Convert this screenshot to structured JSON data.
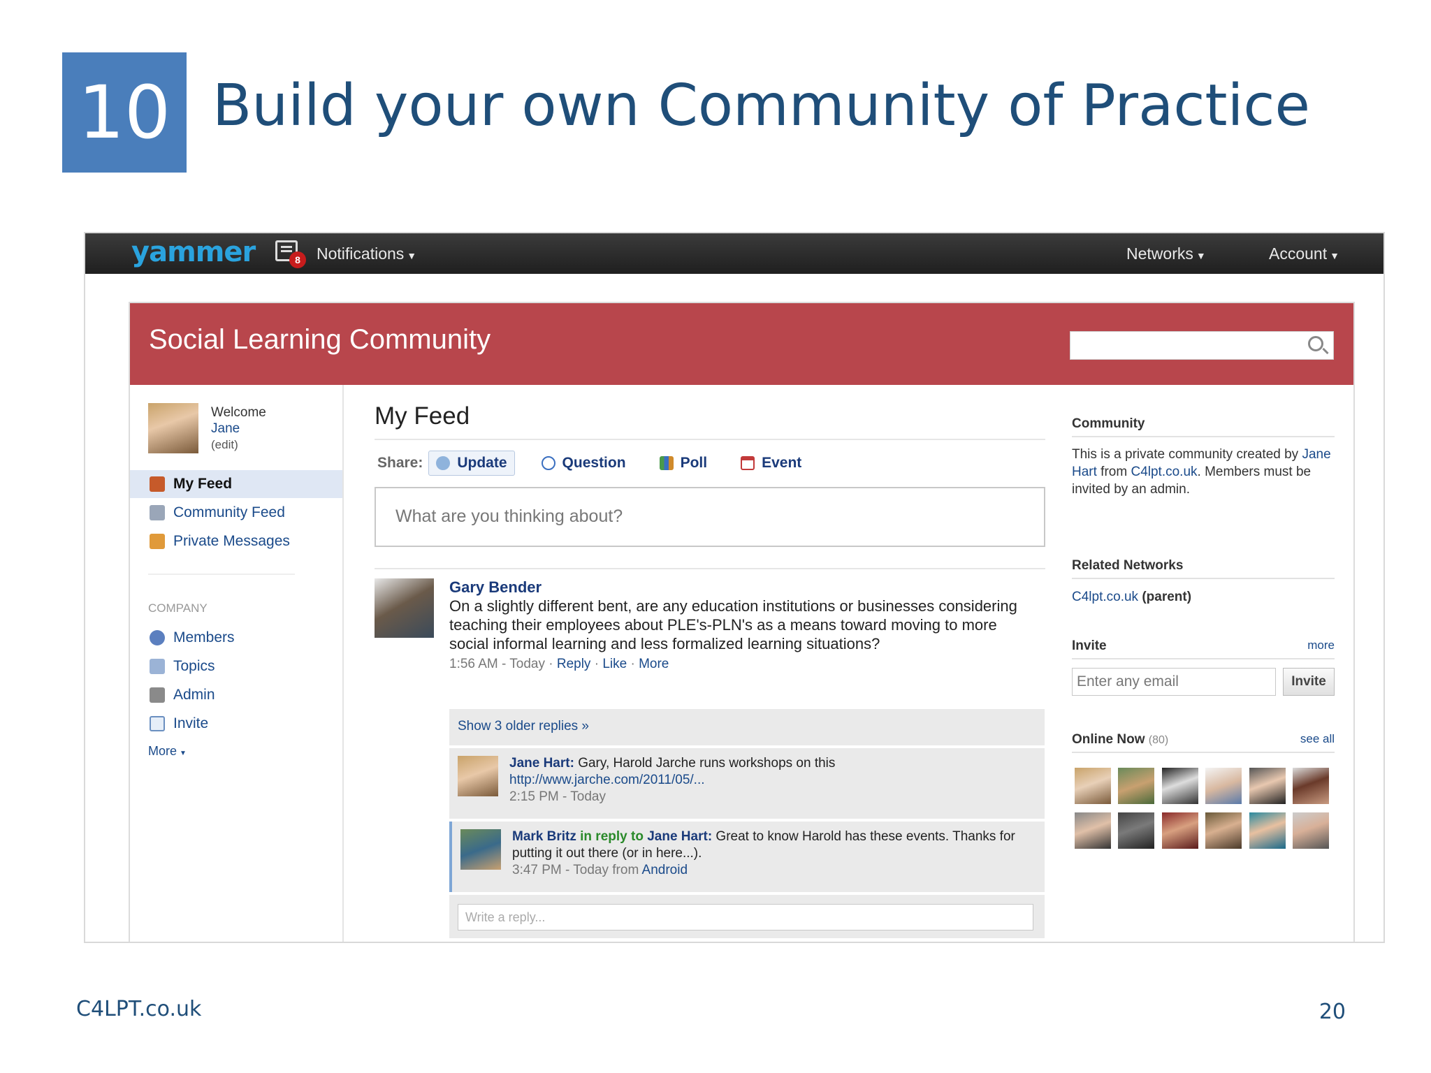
{
  "slide": {
    "number": "10",
    "title": "Build your own Community of Practice",
    "footer_left": "C4LPT.co.uk",
    "page_number": "20"
  },
  "topbar": {
    "logo": "yammer",
    "notifications_count": "8",
    "notifications_label": "Notifications",
    "networks_label": "Networks",
    "account_label": "Account"
  },
  "banner": {
    "title": "Social Learning Community"
  },
  "sidebar": {
    "welcome": "Welcome",
    "user_name": "Jane",
    "edit": "(edit)",
    "nav": [
      {
        "label": "My Feed",
        "icon": "home-icon"
      },
      {
        "label": "Community Feed",
        "icon": "building-icon"
      },
      {
        "label": "Private Messages",
        "icon": "inbox-icon"
      }
    ],
    "company_label": "COMPANY",
    "company_links": [
      {
        "label": "Members",
        "icon": "members-icon"
      },
      {
        "label": "Topics",
        "icon": "tag-icon"
      },
      {
        "label": "Admin",
        "icon": "wrench-icon"
      },
      {
        "label": "Invite",
        "icon": "envelope-icon"
      }
    ],
    "more": "More"
  },
  "feed": {
    "title": "My Feed",
    "share_label": "Share:",
    "share_options": [
      {
        "label": "Update",
        "icon": "speech-bubble-icon",
        "color": "#8fb3dc"
      },
      {
        "label": "Question",
        "icon": "question-icon",
        "color": "#3a6fc0"
      },
      {
        "label": "Poll",
        "icon": "bar-chart-icon",
        "color": "#4a9a4a"
      },
      {
        "label": "Event",
        "icon": "calendar-icon",
        "color": "#c23a3a"
      }
    ],
    "composer_placeholder": "What are you thinking about?",
    "post": {
      "author": "Gary Bender",
      "text": "On a slightly different bent, are any education institutions or businesses considering teaching their employees about PLE's-PLN's as a means toward moving to more social informal learning and less formalized learning situations?",
      "time": "1:56 AM - Today",
      "reply": "Reply",
      "like": "Like",
      "more": "More"
    },
    "older_replies": "Show 3 older replies »",
    "replies": [
      {
        "author": "Jane Hart:",
        "text": " Gary, Harold Jarche runs workshops on this",
        "link": "http://www.jarche.com/2011/05/...",
        "meta": "2:15 PM - Today"
      },
      {
        "author": "Mark Britz",
        "in_reply_to": " in reply to ",
        "target": "Jane Hart:",
        "text": " Great to know Harold has these events. Thanks for putting it out there (or in here...).",
        "meta": "3:47 PM - Today from ",
        "meta_link": "Android"
      }
    ],
    "write_reply_placeholder": "Write a reply..."
  },
  "rightcol": {
    "community_head": "Community",
    "community_text_1": "This is a private community created by ",
    "community_author": "Jane Hart",
    "community_text_2": " from ",
    "community_link": "C4lpt.co.uk",
    "community_text_3": ". Members must be invited by an admin.",
    "related_head": "Related Networks",
    "related_link": "C4lpt.co.uk",
    "related_suffix": " (parent)",
    "invite_head": "Invite",
    "invite_more": "more",
    "invite_placeholder": "Enter any email",
    "invite_button": "Invite",
    "online_head": "Online Now",
    "online_count": "(80)",
    "see_all": "see all"
  }
}
